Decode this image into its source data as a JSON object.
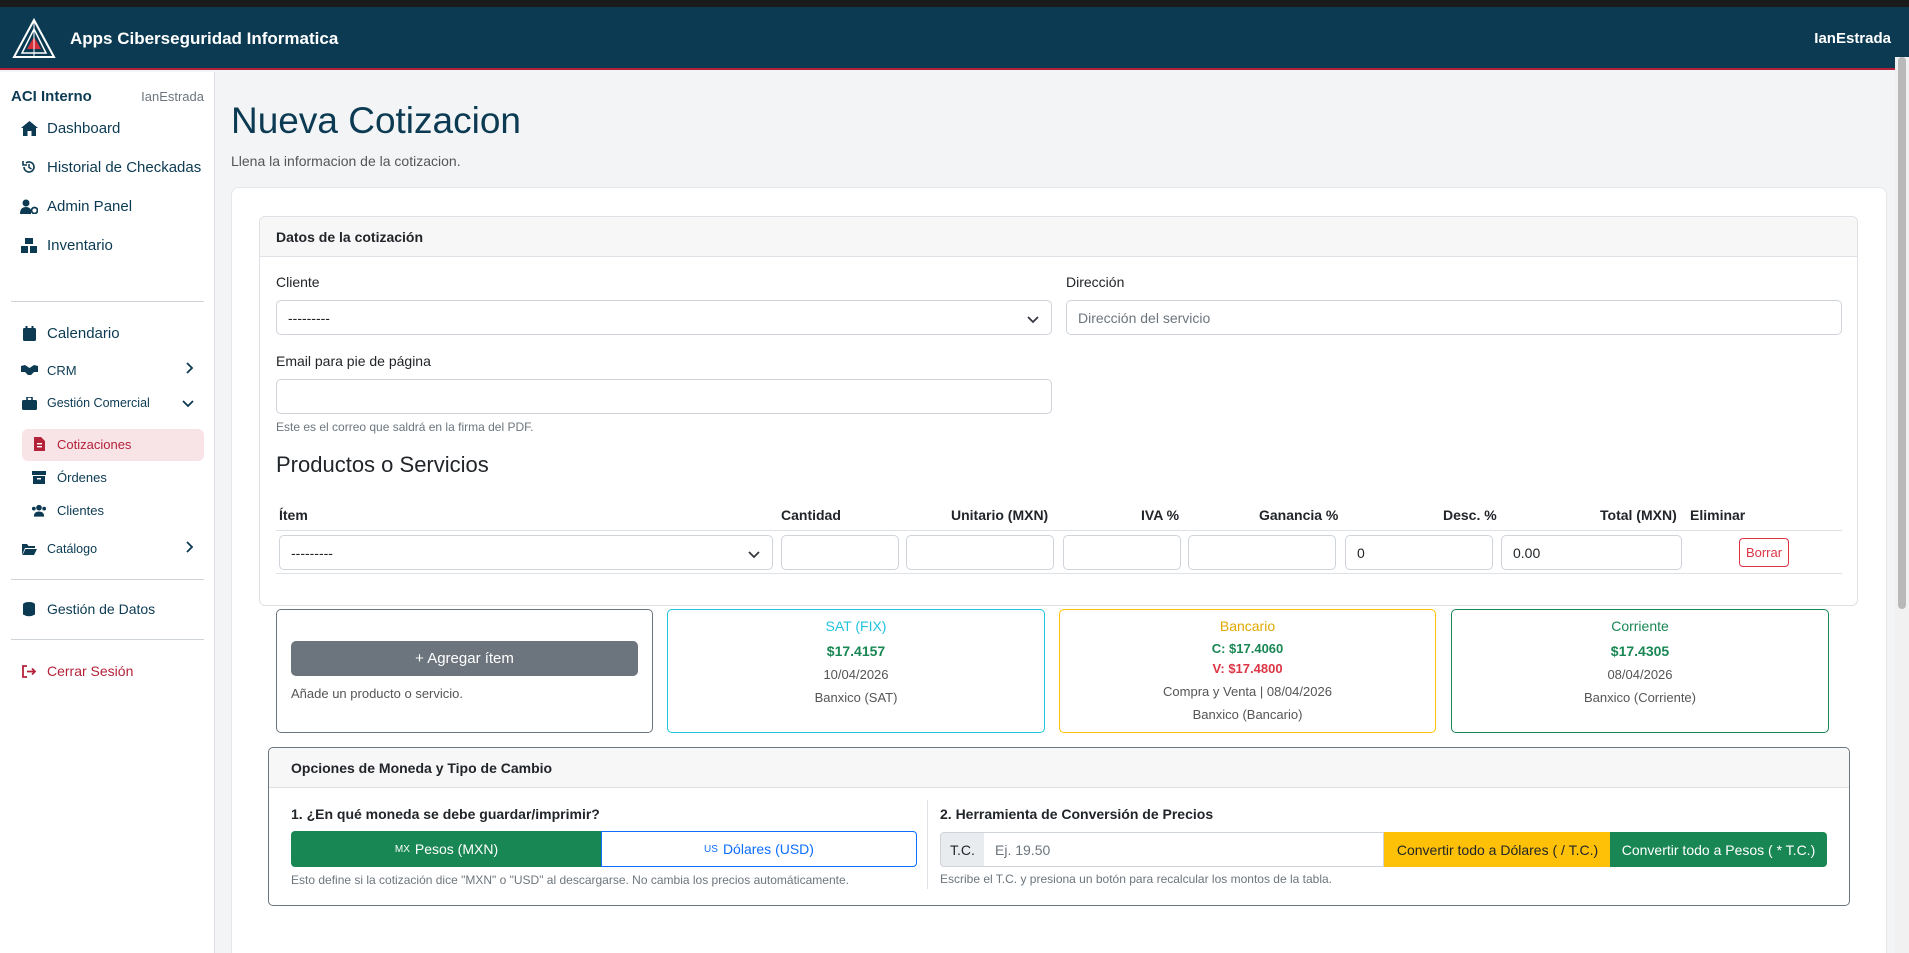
{
  "app": {
    "brand": "Apps Ciberseguridad Informatica",
    "user": "IanEstrada"
  },
  "sidebar": {
    "title": "ACI Interno",
    "user": "IanEstrada",
    "items": [
      {
        "label": "Dashboard",
        "icon": "home-icon"
      },
      {
        "label": "Historial de Checkadas",
        "icon": "history-icon"
      },
      {
        "label": "Admin Panel",
        "icon": "user-gear-icon"
      },
      {
        "label": "Inventario",
        "icon": "boxes-icon"
      },
      {
        "label": "Calendario",
        "icon": "calendar-icon"
      },
      {
        "label": "CRM",
        "icon": "handshake-icon"
      },
      {
        "label": "Gestión Comercial",
        "icon": "briefcase-icon"
      },
      {
        "label": "Catálogo",
        "icon": "folder-icon"
      },
      {
        "label": "Gestión de Datos",
        "icon": "database-icon"
      },
      {
        "label": "Cerrar Sesión",
        "icon": "logout-icon"
      }
    ],
    "sub_items": [
      {
        "label": "Cotizaciones",
        "icon": "file-invoice-icon"
      },
      {
        "label": "Órdenes",
        "icon": "archive-icon"
      },
      {
        "label": "Clientes",
        "icon": "users-icon"
      }
    ]
  },
  "page": {
    "title": "Nueva Cotizacion",
    "subtitle": "Llena la informacion de la cotizacion."
  },
  "datos": {
    "header": "Datos de la cotización",
    "cliente_label": "Cliente",
    "cliente_value": "---------",
    "direccion_label": "Dirección",
    "direccion_placeholder": "Dirección del servicio",
    "email_label": "Email para pie de página",
    "email_help": "Este es el correo que saldrá en la firma del PDF."
  },
  "productos": {
    "title": "Productos o Servicios",
    "columns": [
      "Ítem",
      "Cantidad",
      "Unitario (MXN)",
      "IVA %",
      "Ganancia %",
      "Desc. %",
      "Total (MXN)",
      "Eliminar"
    ],
    "row": {
      "item": "---------",
      "cantidad": "",
      "unitario": "",
      "iva": "",
      "ganancia": "",
      "desc": "0",
      "total": "0.00",
      "delete_label": "Borrar"
    }
  },
  "add_item": {
    "button": "+ Agregar ítem",
    "help": "Añade un producto o servicio."
  },
  "rates": {
    "sat": {
      "title": "SAT (FIX)",
      "value": "$17.4157",
      "date": "10/04/2026",
      "source": "Banxico (SAT)"
    },
    "bancario": {
      "title": "Bancario",
      "compra": "C: $17.4060",
      "venta": "V: $17.4800",
      "date": "Compra y Venta | 08/04/2026",
      "source": "Banxico (Bancario)"
    },
    "corriente": {
      "title": "Corriente",
      "value": "$17.4305",
      "date": "08/04/2026",
      "source": "Banxico (Corriente)"
    }
  },
  "moneda": {
    "header": "Opciones de Moneda y Tipo de Cambio",
    "q1": "1. ¿En qué moneda se debe guardar/imprimir?",
    "mxn_prefix": "MX",
    "mxn_label": "Pesos (MXN)",
    "usd_prefix": "US",
    "usd_label": "Dólares (USD)",
    "help1": "Esto define si la cotización dice \"MXN\" o \"USD\" al descargarse. No cambia los precios automáticamente.",
    "q2": "2. Herramienta de Conversión de Precios",
    "tc_label": "T.C.",
    "tc_placeholder": "Ej. 19.50",
    "to_usd_button": "Convertir todo a Dólares ( / T.C.)",
    "to_mxn_button": "Convertir todo a Pesos ( * T.C.)",
    "help2": "Escribe el T.C. y presiona un botón para recalcular los montos de la tabla."
  },
  "colors": {
    "navbar": "#0b3a52",
    "accent": "#b4223a",
    "success": "#198754",
    "warning": "#ffc107",
    "info": "#22c3de",
    "primary": "#0d6efd"
  }
}
